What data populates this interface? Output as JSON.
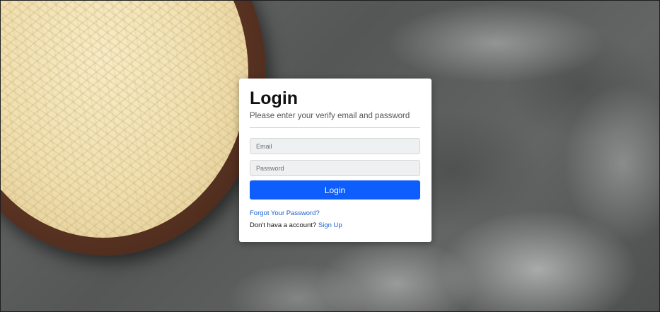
{
  "login": {
    "title": "Login",
    "subtitle": "Please enter your verify email and password",
    "email_placeholder": "Email",
    "password_placeholder": "Password",
    "submit_label": "Login",
    "forgot_password_link": "Forgot Your Password?",
    "no_account_text": "Don't hava a account?",
    "signup_link": "Sign Up"
  },
  "colors": {
    "primary_button": "#0d5efc",
    "link": "#1a5fd0"
  }
}
